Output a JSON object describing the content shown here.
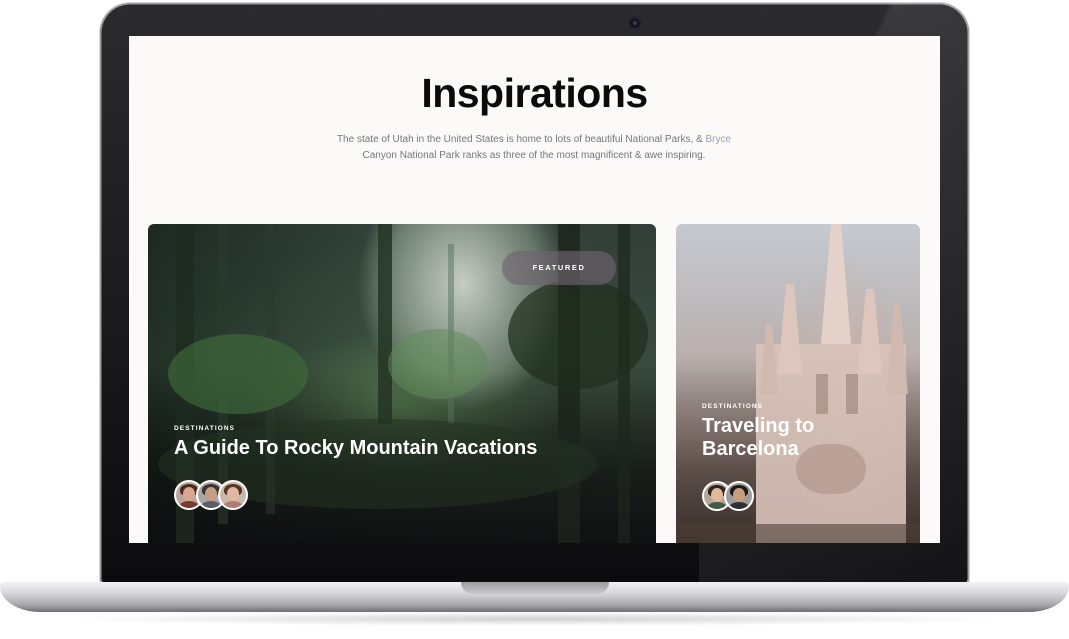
{
  "page": {
    "title": "Inspirations",
    "intro_text": "The state of Utah in the United States is home to lots of beautiful National Parks, &",
    "intro_link": "Bryce",
    "intro_continuation": "Canyon National Park ranks as three of the most magnificent & awe inspiring."
  },
  "cards": [
    {
      "badge": "FEATURED",
      "category": "DESTINATIONS",
      "title": "A Guide To Rocky Mountain Vacations",
      "authors": [
        "author-1",
        "author-2",
        "author-3"
      ]
    },
    {
      "category": "DESTINATIONS",
      "title_line1": "Traveling to",
      "title_line2": "Barcelona",
      "authors": [
        "author-1",
        "author-2"
      ]
    }
  ],
  "colors": {
    "background": "#fbfaf8",
    "title": "#0b0b0b",
    "subtitle": "#727782",
    "link": "#9aa2b4",
    "badge_bg": "#6e646e"
  },
  "icons": {
    "camera": "webcam-icon"
  }
}
